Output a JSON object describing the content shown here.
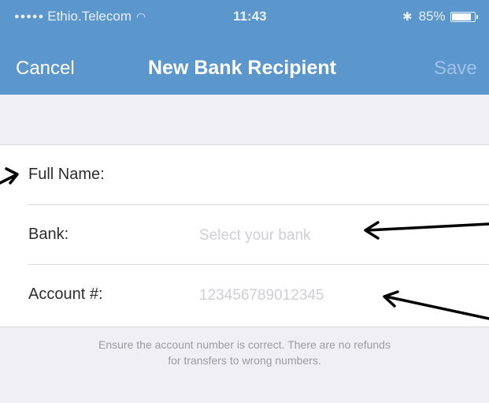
{
  "status_bar": {
    "carrier": "Ethio.Telecom",
    "signal_dots": "●●●●●",
    "time": "11:43",
    "battery_percent": "85%",
    "battery_level": 0.85
  },
  "nav": {
    "cancel_label": "Cancel",
    "title": "New Bank Recipient",
    "save_label": "Save"
  },
  "form": {
    "full_name": {
      "label": "Full Name:"
    },
    "bank": {
      "label": "Bank:",
      "placeholder": "Select your bank"
    },
    "account": {
      "label": "Account #:",
      "placeholder": "123456789012345"
    }
  },
  "note": {
    "line1": "Ensure the account number is correct. There are no refunds",
    "line2": "for transfers to wrong numbers."
  },
  "colors": {
    "nav_blue": "#5b96cc",
    "background": "#efeff4",
    "placeholder": "#cfcfd4",
    "annotation_arrow": "#000000"
  }
}
